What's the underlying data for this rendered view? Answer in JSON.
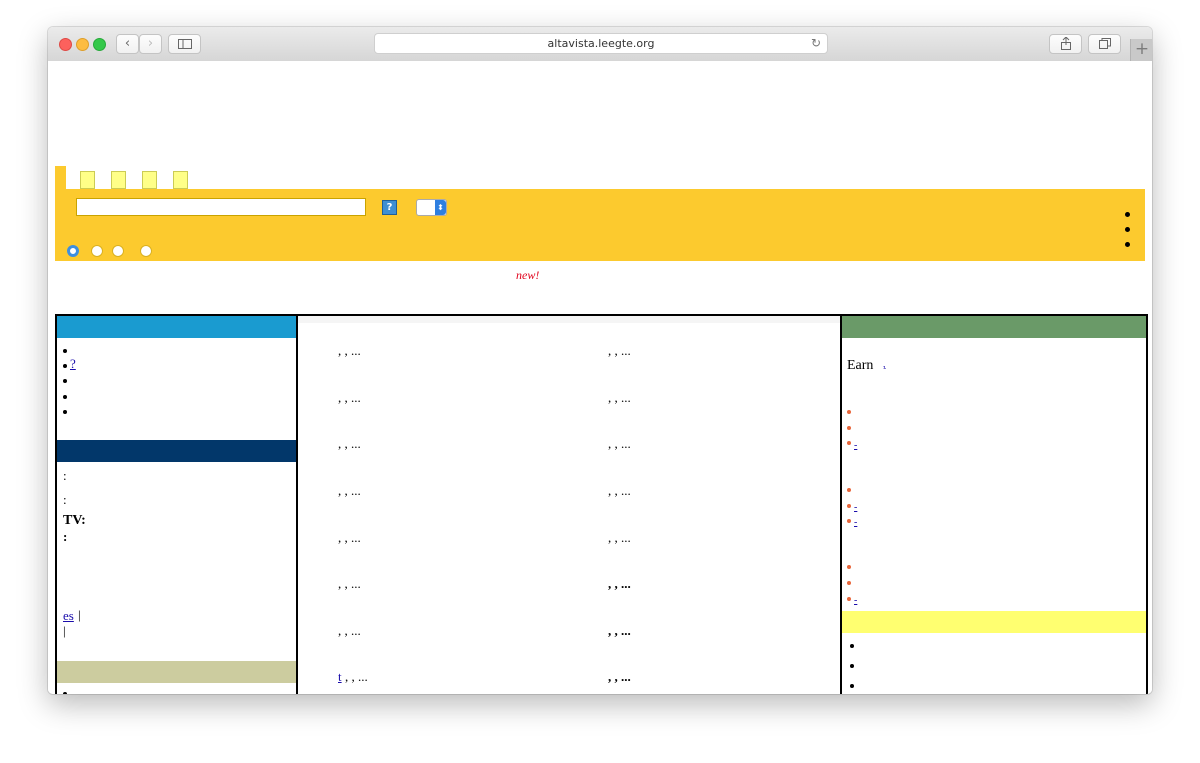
{
  "browser": {
    "url": "altavista.leegte.org",
    "reload_glyph": "↻",
    "back_glyph": "‹",
    "forward_glyph": "›",
    "newtab_glyph": "+"
  },
  "search": {
    "input_value": "",
    "help_label": "?",
    "select_caret": "⬍",
    "radios": [
      {
        "selected": true
      },
      {
        "selected": false
      },
      {
        "selected": false
      },
      {
        "selected": false
      }
    ]
  },
  "new_badge": "new!",
  "left": {
    "section1_colors": "#1a9bd0",
    "section1_link": "?",
    "section2_lines": [
      ":",
      ":"
    ],
    "tv_label": "TV:",
    "colon": ":",
    "link_es": "es",
    "pipe": "|"
  },
  "middle": {
    "rows": [
      {
        "left": ", , ...",
        "right": ", , ..."
      },
      {
        "left": ", , ...",
        "right": ", , ..."
      },
      {
        "left": ", , ...",
        "right": ", , ..."
      },
      {
        "left": ", , ...",
        "right": ", , ..."
      },
      {
        "left": ", , ...",
        "right": ", , ..."
      },
      {
        "left": ", , ...",
        "right": ", , ..."
      },
      {
        "left": ", , ...",
        "right": ", , ..."
      },
      {
        "left_link": "t",
        "left": ", , ...",
        "right": ", , ..."
      }
    ]
  },
  "right": {
    "earn_label": "Earn",
    "earn_link": ",",
    "dash": "-"
  },
  "colors": {
    "yellow_band": "#fcca2e",
    "blue_header": "#1a9bd0",
    "navy_header": "#02376a",
    "tan_header": "#cccc9f",
    "green_header": "#6a9a68",
    "lightyellow_header": "#ffff70"
  }
}
